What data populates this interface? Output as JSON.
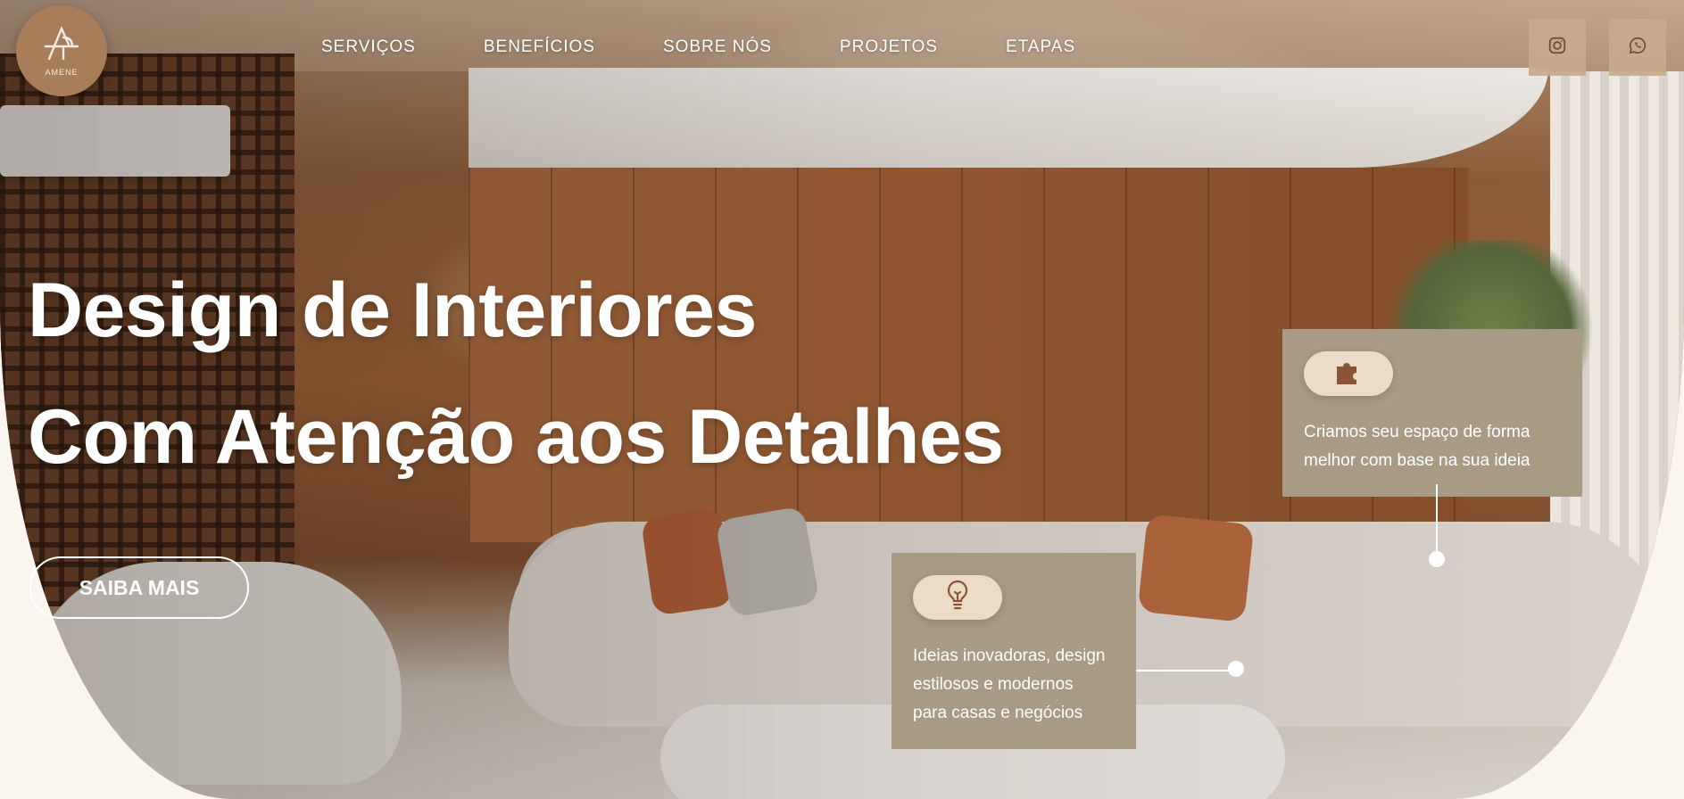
{
  "brand": {
    "logo_text": "AMENE",
    "logo_icon": "amene-monogram"
  },
  "nav": {
    "items": [
      {
        "label": "SERVIÇOS"
      },
      {
        "label": "BENEFÍCIOS"
      },
      {
        "label": "SOBRE NÓS"
      },
      {
        "label": "PROJETOS"
      },
      {
        "label": "ETAPAS"
      }
    ]
  },
  "social": [
    {
      "icon": "instagram-icon"
    },
    {
      "icon": "whatsapp-icon"
    }
  ],
  "hero": {
    "headline_line1": "Design de Interiores",
    "headline_line2": "Com Atenção aos Detalhes",
    "cta_label": "SAIBA MAIS"
  },
  "cards": [
    {
      "icon": "puzzle-icon",
      "text_line1": "Criamos seu espaço de forma",
      "text_line2": "melhor com base na sua ideia"
    },
    {
      "icon": "lightbulb-icon",
      "text_line1": "Ideias inovadoras, design",
      "text_line2": "estilosos e modernos",
      "text_line3": "para casas e negócios"
    }
  ],
  "colors": {
    "accent": "#a99a84",
    "pill": "#ecdcc6",
    "social_bg": "#c7ab8f",
    "icon_brown": "#8a5436"
  }
}
